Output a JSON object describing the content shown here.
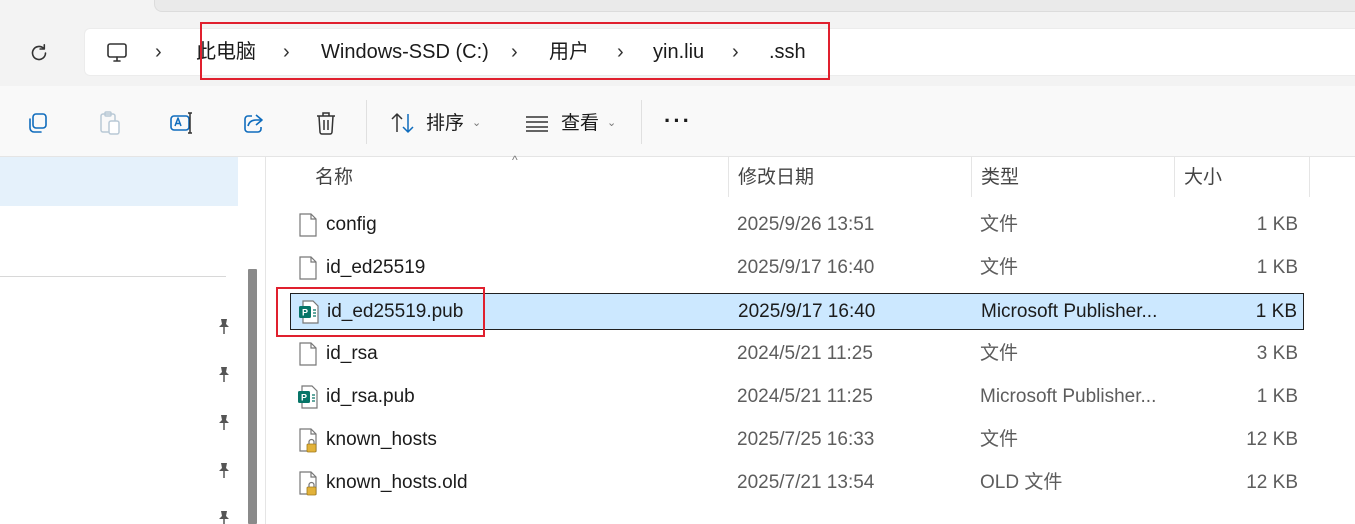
{
  "breadcrumb": {
    "items": [
      "此电脑",
      "Windows-SSD (C:)",
      "用户",
      "yin.liu",
      ".ssh"
    ],
    "separator": "›"
  },
  "toolbar": {
    "sort_label": "排序",
    "view_label": "查看",
    "more_label": "···"
  },
  "columns": {
    "name": "名称",
    "modified": "修改日期",
    "type": "类型",
    "size": "大小"
  },
  "files": [
    {
      "name": "config",
      "modified": "2025/9/26 13:51",
      "type": "文件",
      "size": "1 KB",
      "icon": "blank-file-icon"
    },
    {
      "name": "id_ed25519",
      "modified": "2025/9/17 16:40",
      "type": "文件",
      "size": "1 KB",
      "icon": "blank-file-icon"
    },
    {
      "name": "id_ed25519.pub",
      "modified": "2025/9/17 16:40",
      "type": "Microsoft Publisher...",
      "size": "1 KB",
      "icon": "publisher-file-icon",
      "selected": true
    },
    {
      "name": "id_rsa",
      "modified": "2024/5/21 11:25",
      "type": "文件",
      "size": "3 KB",
      "icon": "blank-file-icon"
    },
    {
      "name": "id_rsa.pub",
      "modified": "2024/5/21 11:25",
      "type": "Microsoft Publisher...",
      "size": "1 KB",
      "icon": "publisher-file-icon"
    },
    {
      "name": "known_hosts",
      "modified": "2025/7/25 16:33",
      "type": "文件",
      "size": "12 KB",
      "icon": "locked-file-icon"
    },
    {
      "name": "known_hosts.old",
      "modified": "2025/7/21 13:54",
      "type": "OLD 文件",
      "size": "12 KB",
      "icon": "locked-file-icon"
    }
  ],
  "colors": {
    "selection": "#cce8ff",
    "annotation": "#e0202e",
    "publisher": "#077568"
  }
}
